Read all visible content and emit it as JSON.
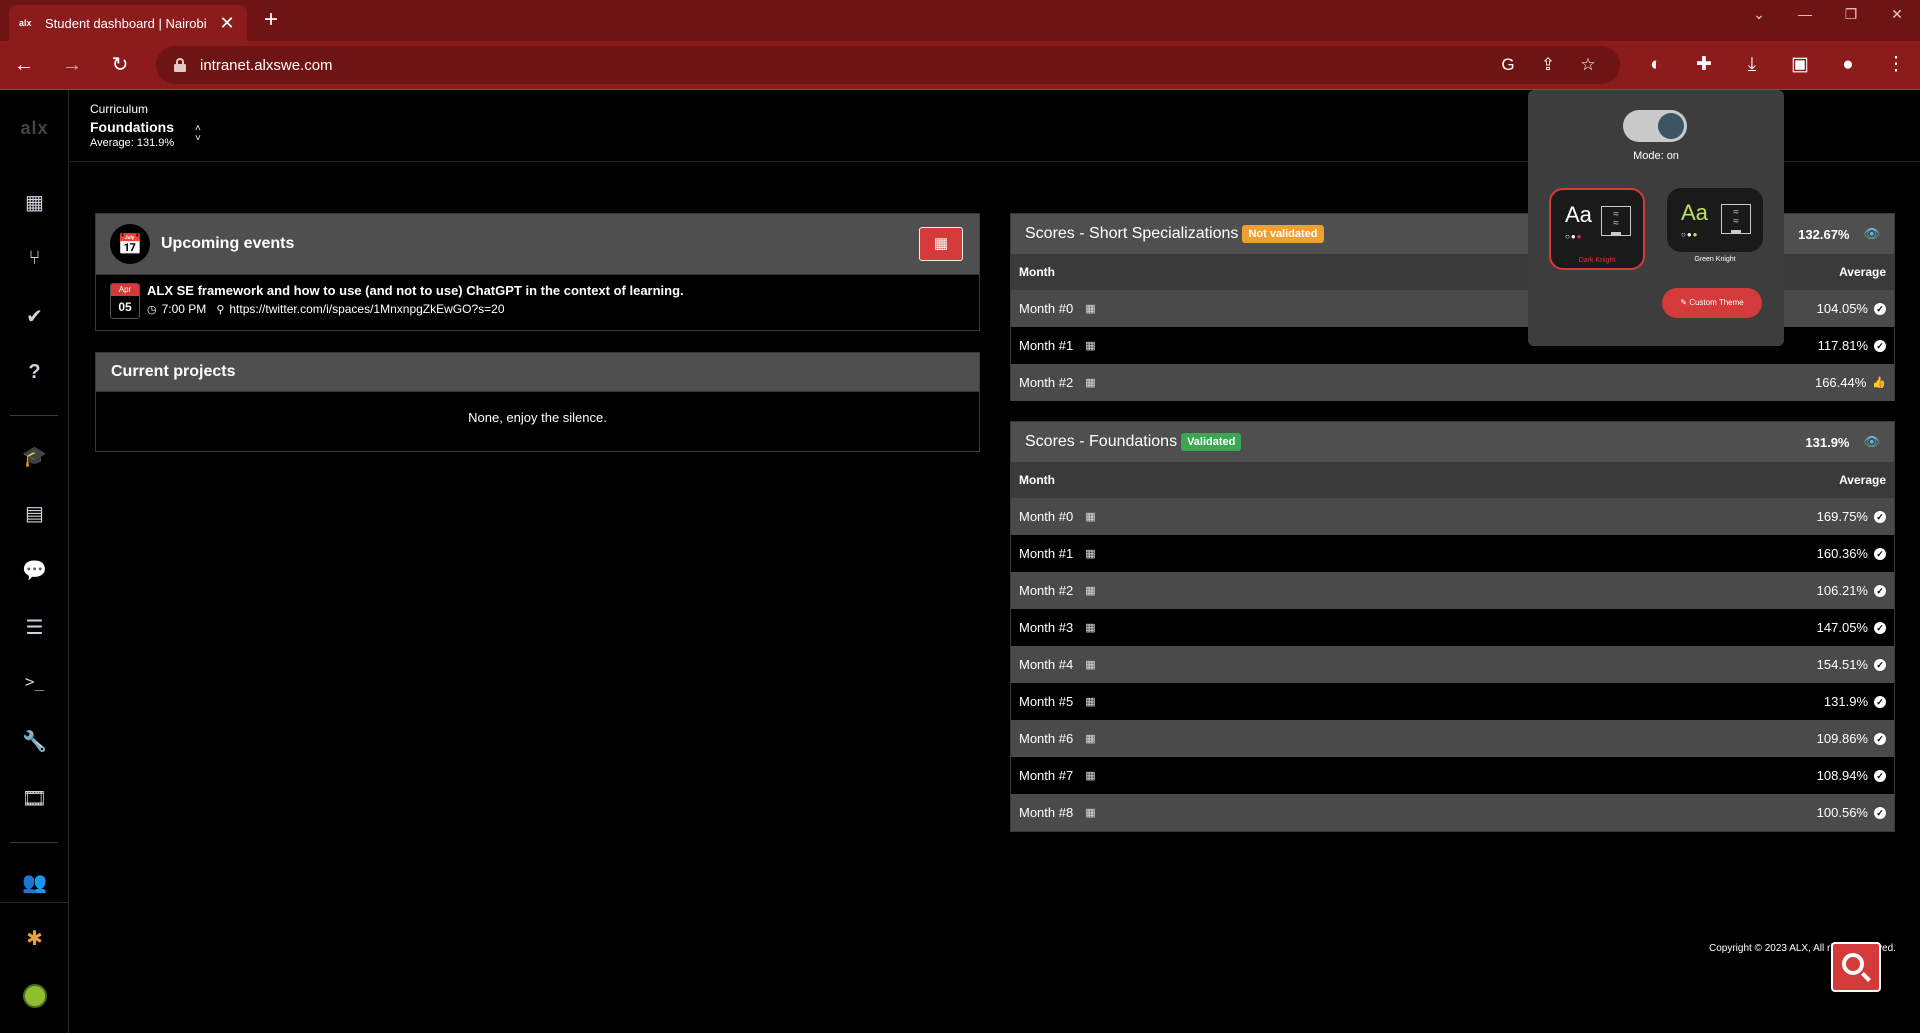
{
  "browser": {
    "tab_title": "Student dashboard | Nairobi Intranet",
    "tab_favicon": "alx",
    "url": "intranet.alxswe.com",
    "icons": [
      "google-icon",
      "share-icon",
      "star-icon",
      "dark-mode-icon",
      "extensions-icon",
      "download-icon",
      "sidepanel-icon",
      "profile-icon",
      "menu-icon"
    ]
  },
  "sidebar": {
    "logo": "alx",
    "items": [
      "calendar",
      "git-branch",
      "check",
      "help",
      "graduation",
      "document",
      "chat",
      "servers",
      "terminal",
      "wrench",
      "film",
      "group",
      "slack",
      "avatar"
    ]
  },
  "curriculum": {
    "label": "Curriculum",
    "title": "Foundations",
    "average": "Average: 131.9%"
  },
  "events": {
    "title": "Upcoming events",
    "items": [
      {
        "month": "Apr",
        "day": "05",
        "title": "ALX SE framework and how to use (and not to use) ChatGPT in the context of learning.",
        "time": "7:00 PM",
        "location": "https://twitter.com/i/spaces/1MnxnpgZkEwGO?s=20"
      }
    ]
  },
  "projects": {
    "title": "Current projects",
    "empty": "None, enjoy the silence."
  },
  "short_spec": {
    "title": "Scores - Short Specializations",
    "badge": "Not validated",
    "total": "132.67%",
    "col_month": "Month",
    "col_avg": "Average",
    "rows": [
      {
        "month": "Month #0",
        "value": "104.05%"
      },
      {
        "month": "Month #1",
        "value": "117.81%"
      },
      {
        "month": "Month #2",
        "value": "166.44%"
      }
    ]
  },
  "foundations": {
    "title": "Scores - Foundations",
    "badge": "Validated",
    "total": "131.9%",
    "col_month": "Month",
    "col_avg": "Average",
    "rows": [
      {
        "month": "Month #0",
        "value": "169.75%"
      },
      {
        "month": "Month #1",
        "value": "160.36%"
      },
      {
        "month": "Month #2",
        "value": "106.21%"
      },
      {
        "month": "Month #3",
        "value": "147.05%"
      },
      {
        "month": "Month #4",
        "value": "154.51%"
      },
      {
        "month": "Month #5",
        "value": "131.9%"
      },
      {
        "month": "Month #6",
        "value": "109.86%"
      },
      {
        "month": "Month #7",
        "value": "108.94%"
      },
      {
        "month": "Month #8",
        "value": "100.56%"
      }
    ]
  },
  "dark_popup": {
    "mode_label": "Mode: on",
    "theme1_name": "Dark Knight",
    "theme2_name": "Green Knight",
    "custom_label": "Custom Theme",
    "aa": "Aa"
  },
  "footer": {
    "copyright": "Copyright © 2023 ALX, All rights reserved."
  },
  "colors": {
    "accent": "#d43a3a",
    "chrome": "#8c1c1c",
    "validated": "#3ca554",
    "not_validated": "#f0a030"
  }
}
